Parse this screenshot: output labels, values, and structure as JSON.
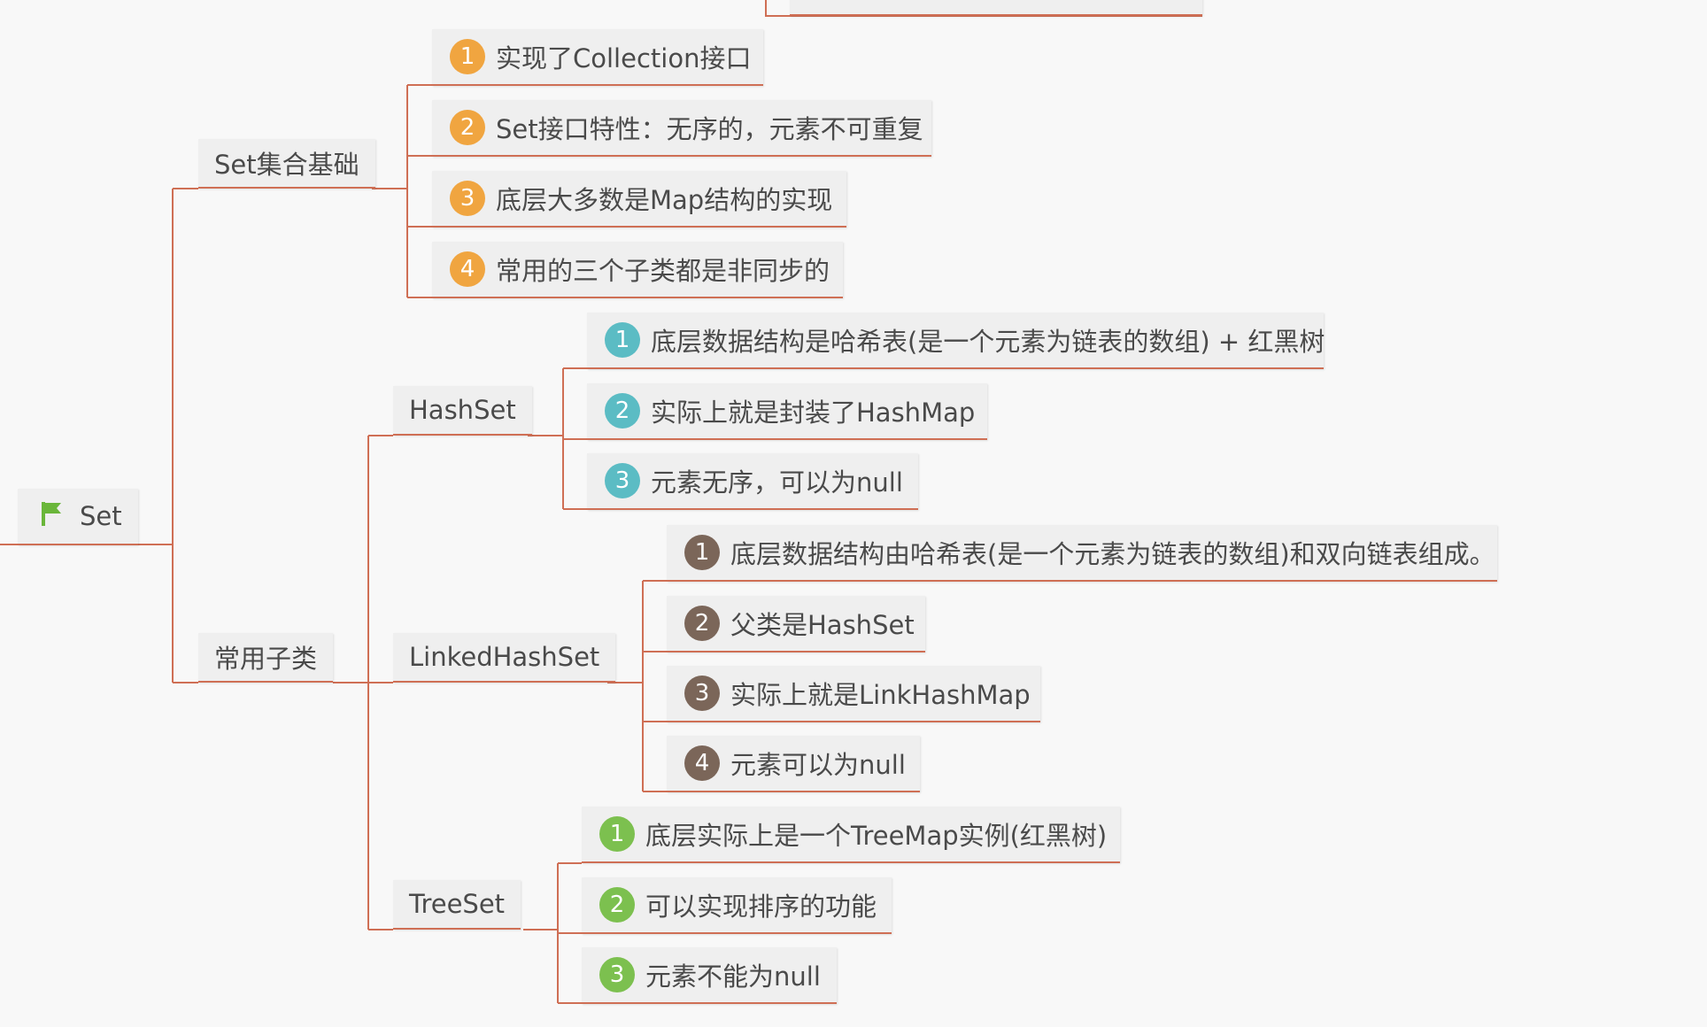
{
  "colors": {
    "line": "#cf6f55",
    "orange": "#f0a540",
    "teal": "#5bbcc4",
    "brown": "#7b6659",
    "green": "#7cc04f",
    "flag": "#6ab63a"
  },
  "root": {
    "label": "Set",
    "icon": "flag-icon"
  },
  "branches": {
    "basics": {
      "label": "Set集合基础",
      "items": [
        {
          "num": "1",
          "text": "实现了Collection接口"
        },
        {
          "num": "2",
          "text": "Set接口特性：无序的，元素不可重复"
        },
        {
          "num": "3",
          "text": "底层大多数是Map结构的实现"
        },
        {
          "num": "4",
          "text": "常用的三个子类都是非同步的"
        }
      ]
    },
    "subclasses": {
      "label": "常用子类",
      "hashset": {
        "label": "HashSet",
        "items": [
          {
            "num": "1",
            "text": "底层数据结构是哈希表(是一个元素为链表的数组) + 红黑树"
          },
          {
            "num": "2",
            "text": "实际上就是封装了HashMap"
          },
          {
            "num": "3",
            "text": "元素无序，可以为null"
          }
        ]
      },
      "linkedhashset": {
        "label": "LinkedHashSet",
        "items": [
          {
            "num": "1",
            "text": "底层数据结构由哈希表(是一个元素为链表的数组)和双向链表组成。"
          },
          {
            "num": "2",
            "text": "父类是HashSet"
          },
          {
            "num": "3",
            "text": "实际上就是LinkHashMap"
          },
          {
            "num": "4",
            "text": "元素可以为null"
          }
        ]
      },
      "treeset": {
        "label": "TreeSet",
        "items": [
          {
            "num": "1",
            "text": "底层实际上是一个TreeMap实例(红黑树)"
          },
          {
            "num": "2",
            "text": "可以实现排序的功能"
          },
          {
            "num": "3",
            "text": "元素不能为null"
          }
        ]
      }
    }
  }
}
